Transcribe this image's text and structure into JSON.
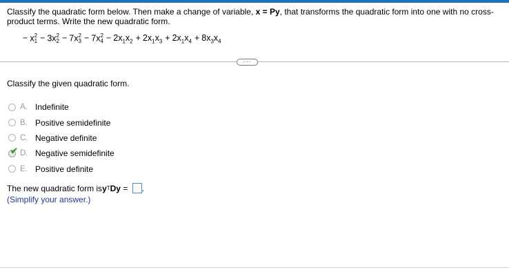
{
  "instructions": {
    "part1": "Classify the quadratic form below. Then make a change of variable, ",
    "eq": "x = Py",
    "part2": ", that transforms the quadratic form into one with no cross-product terms. Write the new quadratic form."
  },
  "expression": {
    "terms": [
      {
        "sign": "−",
        "coef": "",
        "base": "x",
        "sub1": "1",
        "sub2": "",
        "exp": "2"
      },
      {
        "sign": "−",
        "coef": "3",
        "base": "x",
        "sub1": "2",
        "sub2": "",
        "exp": "2"
      },
      {
        "sign": "−",
        "coef": "7",
        "base": "x",
        "sub1": "3",
        "sub2": "",
        "exp": "2"
      },
      {
        "sign": "−",
        "coef": "7",
        "base": "x",
        "sub1": "4",
        "sub2": "",
        "exp": "2"
      },
      {
        "sign": "−",
        "coef": "2",
        "base": "x",
        "sub1": "1",
        "sub2": "2",
        "exp": ""
      },
      {
        "sign": "+",
        "coef": "2",
        "base": "x",
        "sub1": "1",
        "sub2": "3",
        "exp": ""
      },
      {
        "sign": "+",
        "coef": "2",
        "base": "x",
        "sub1": "1",
        "sub2": "4",
        "exp": ""
      },
      {
        "sign": "+",
        "coef": "8",
        "base": "x",
        "sub1": "3",
        "sub2": "4",
        "exp": ""
      }
    ]
  },
  "more_button": "···",
  "question": "Classify the given quadratic form.",
  "options": [
    {
      "letter": "A.",
      "text": "Indefinite",
      "selected": false
    },
    {
      "letter": "B.",
      "text": "Positive semidefinite",
      "selected": false
    },
    {
      "letter": "C.",
      "text": "Negative definite",
      "selected": false
    },
    {
      "letter": "D.",
      "text": "Negative semidefinite",
      "selected": true
    },
    {
      "letter": "E.",
      "text": "Positive definite",
      "selected": false
    }
  ],
  "check_mark": "✔",
  "answer": {
    "prefix": "The new quadratic form is ",
    "y": "y",
    "T": "T",
    "Dy": "Dy",
    "eq": " = ",
    "value": "",
    "period": "."
  },
  "hint": "(Simplify your answer.)",
  "colors": {
    "accent": "#1f6fb3",
    "check": "#3a9a2f",
    "hint": "#1a3a8a",
    "answer_box_border": "#4a8ad6"
  }
}
